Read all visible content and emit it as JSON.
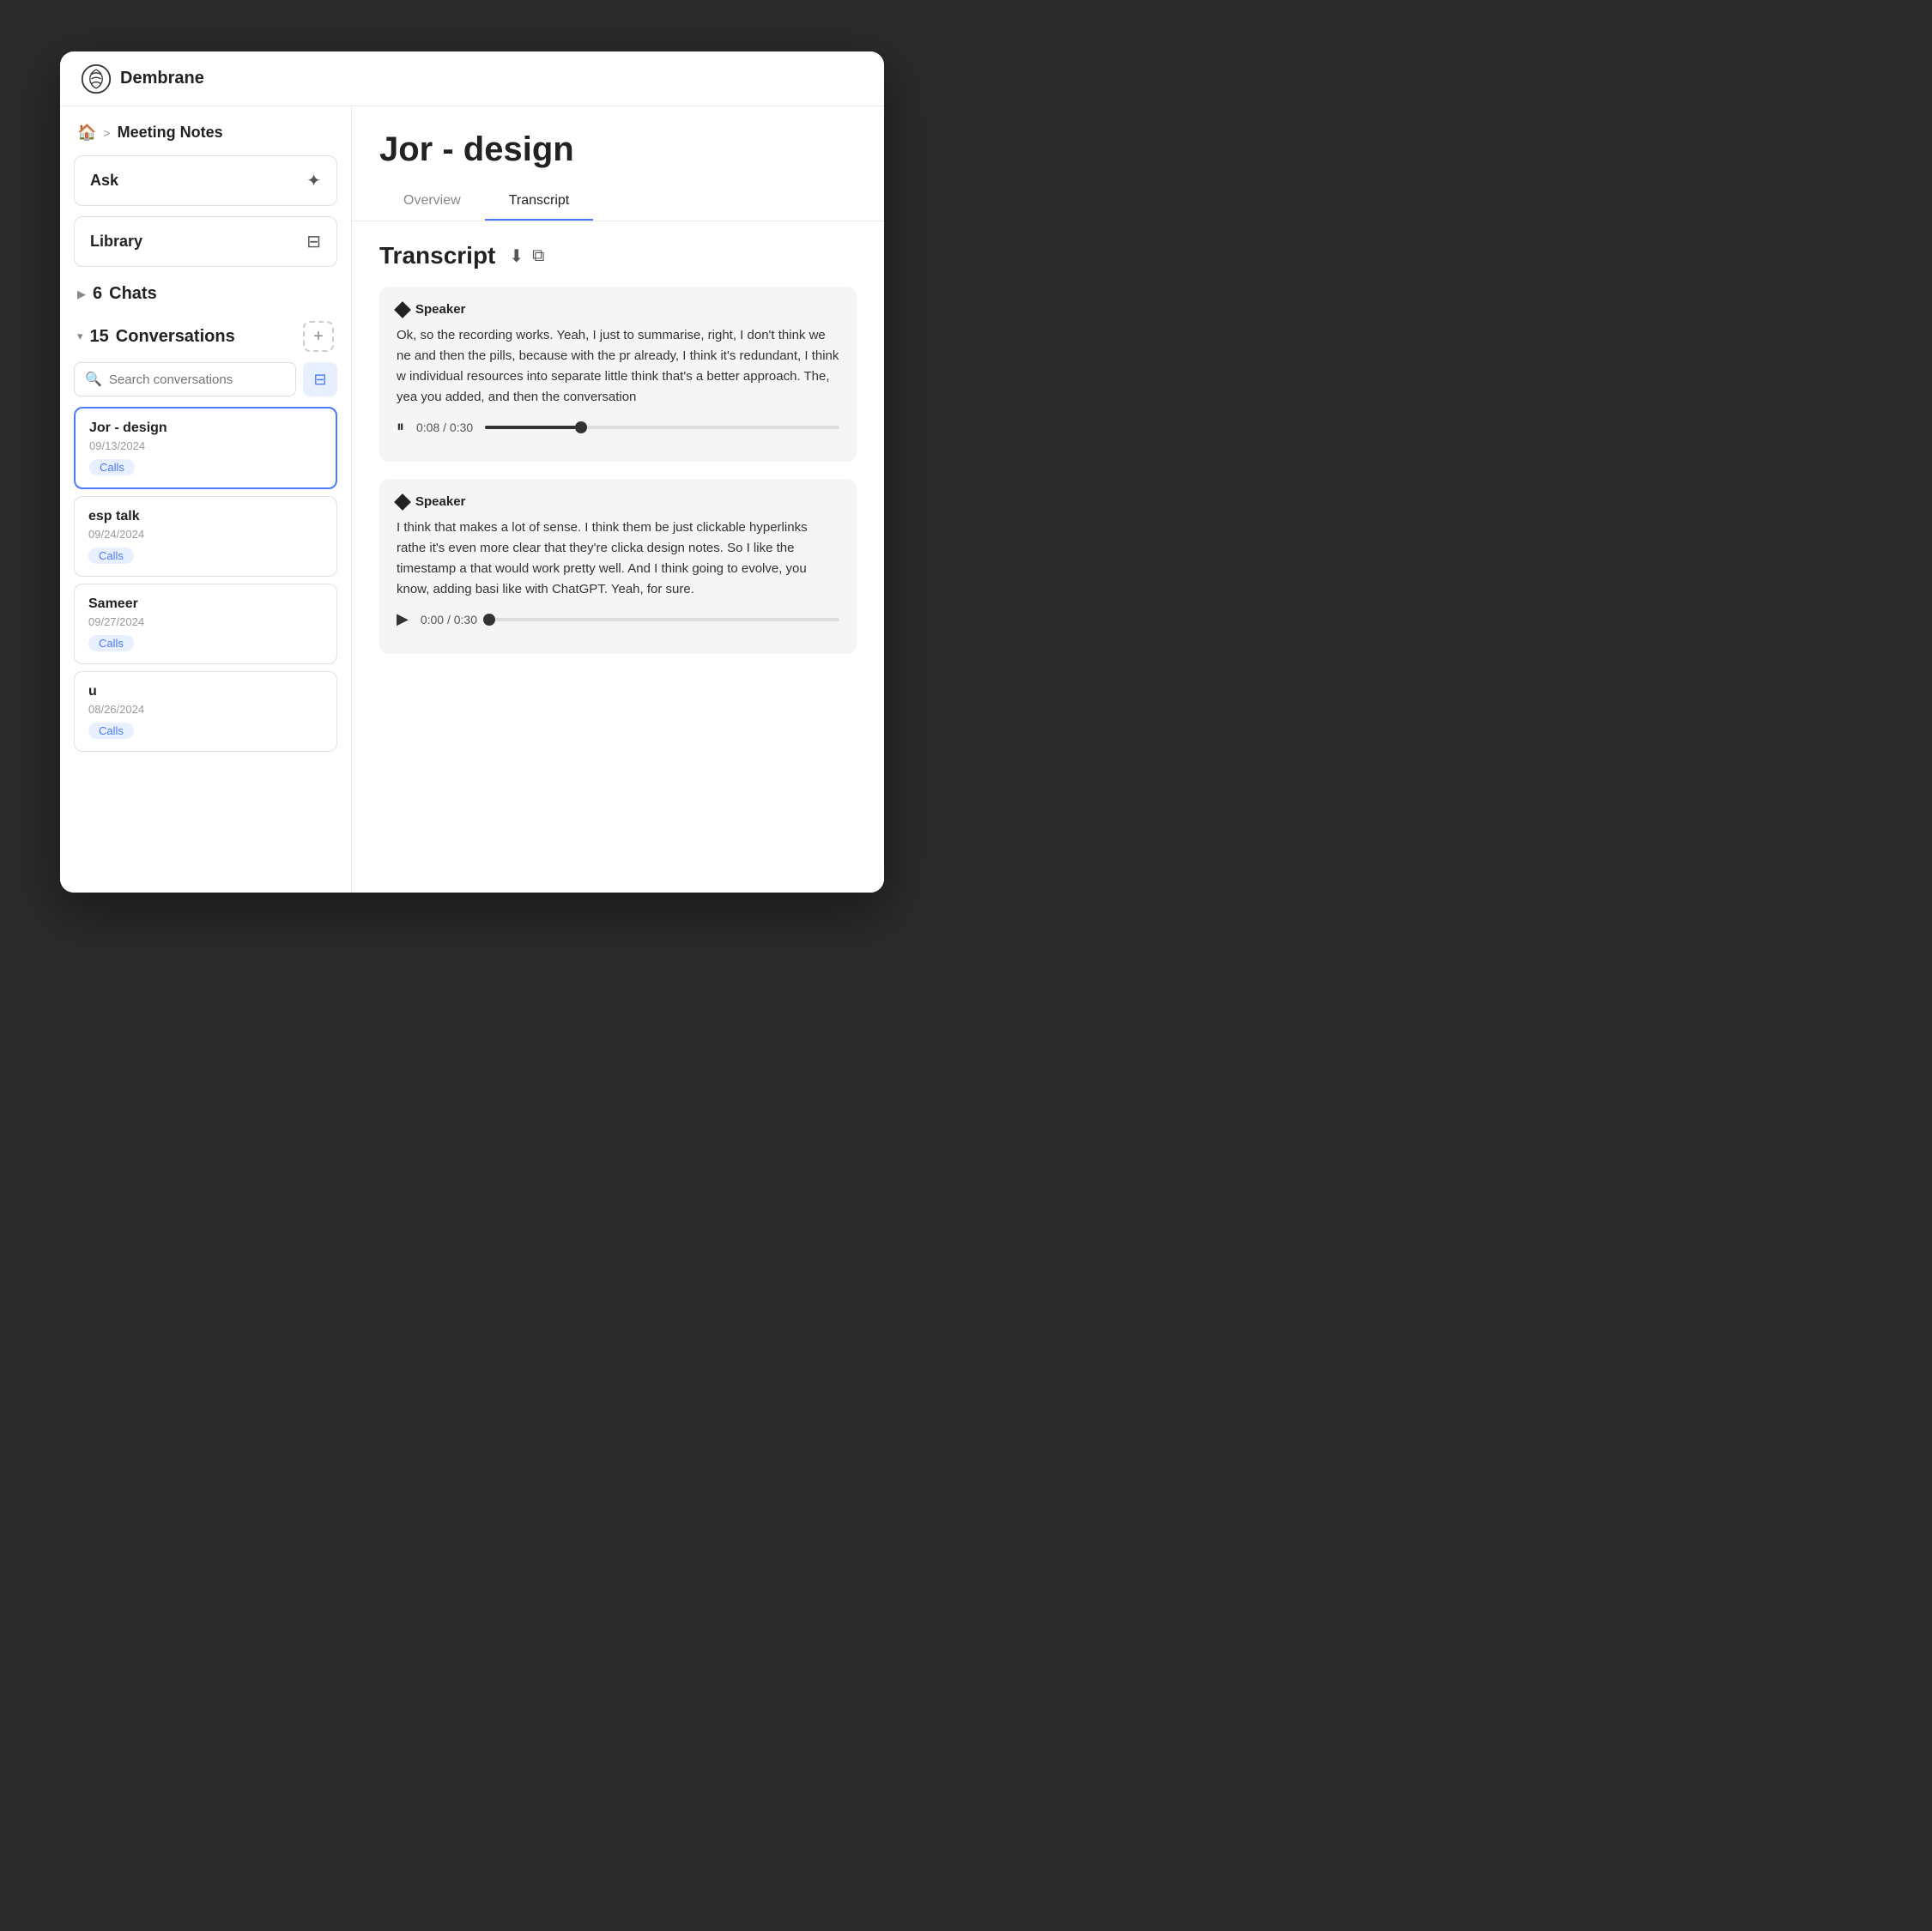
{
  "app": {
    "name": "Dembrane"
  },
  "header": {
    "breadcrumb_home": "🏠",
    "breadcrumb_sep": ">",
    "breadcrumb_label": "Meeting Notes"
  },
  "sidebar": {
    "ask_label": "Ask",
    "ask_icon": "✦",
    "library_label": "Library",
    "library_icon": "⊟",
    "chats_count": "6",
    "chats_label": "Chats",
    "conversations_count": "15",
    "conversations_label": "Conversations",
    "search_placeholder": "Search conversations",
    "add_icon": "+",
    "conversations": [
      {
        "title": "Jor - design",
        "date": "09/13/2024",
        "tag": "Calls",
        "active": true
      },
      {
        "title": "esp talk",
        "date": "09/24/2024",
        "tag": "Calls",
        "active": false
      },
      {
        "title": "Sameer",
        "date": "09/27/2024",
        "tag": "Calls",
        "active": false
      },
      {
        "title": "u",
        "date": "08/26/2024",
        "tag": "Calls",
        "active": false
      }
    ]
  },
  "main": {
    "title": "Jor - design",
    "tabs": [
      {
        "label": "Overview",
        "active": false
      },
      {
        "label": "Transcript",
        "active": true
      }
    ],
    "transcript_label": "Transcript",
    "speakers": [
      {
        "name": "Speaker",
        "text": "Ok, so the recording works. Yeah, I just to summarise, right, I don't think we ne and then the pills, because with the pr already, I think it's redundant, I think w individual resources into separate little think that's a better approach. The, yea you added, and then the conversation",
        "audio_current": "0:08",
        "audio_total": "0:30",
        "progress_pct": 27,
        "playing": true
      },
      {
        "name": "Speaker",
        "text": "I think that makes a lot of sense. I think them be just clickable hyperlinks rathe it's even more clear that they're clicka design notes. So I like the timestamp a that would work pretty well. And I think going to evolve, you know, adding basi like with ChatGPT. Yeah, for sure.",
        "audio_current": "0:00",
        "audio_total": "0:30",
        "progress_pct": 0,
        "playing": false
      }
    ]
  }
}
